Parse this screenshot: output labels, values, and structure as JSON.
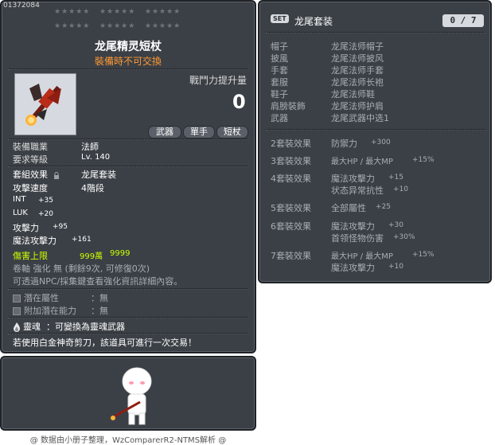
{
  "item_id": "01372084",
  "stars_row1": [
    "★★★★★",
    "★★★★★",
    "★★★★★"
  ],
  "stars_row2": [
    "★★★★★",
    "★★★★★",
    "★★★★★"
  ],
  "item_name": "龙尾精灵短杖",
  "untradeable": "裝備時不可交換",
  "power_label": "戰鬥力提升量",
  "power_value": "0",
  "tags": [
    "武器",
    "單手",
    "短杖"
  ],
  "req": [
    {
      "label": "裝備職業",
      "value": "法師"
    },
    {
      "label": "要求等級",
      "value": "Lv. 140"
    }
  ],
  "set_effect_label": "套組效果",
  "set_effect_value": "龙尾套装",
  "attack_speed_label": "攻擊速度",
  "attack_speed_value": "4階段",
  "stats": [
    {
      "label": "INT",
      "value": "+35"
    },
    {
      "label": "LUK",
      "value": "+20"
    },
    {
      "label": "攻擊力",
      "value": "+95"
    },
    {
      "label": "魔法攻擊力",
      "value": "+161"
    }
  ],
  "damage_cap_label": "傷害上限",
  "damage_cap_value1": "999萬",
  "damage_cap_value2": "9999",
  "scroll_line": "卷軸 強化 無 (剩餘9次, 可修復0次)",
  "npc_line": "可透過NPC/採集鍵查看強化資訊詳細內容。",
  "potential_label": "潛在屬性",
  "potential_value": "：無",
  "add_potential_label": "附加潛在能力",
  "add_potential_value": "：無",
  "soul_label": "靈魂",
  "soul_value": "：可變換為靈魂武器",
  "scissors_line": "若使用白金神奇剪刀，該道具可進行一次交易！",
  "set_panel": {
    "set_badge": "SET",
    "title": "龙尾套装",
    "count": "0 / 7",
    "items": [
      {
        "slot": "帽子",
        "name": "龙尾法师帽子"
      },
      {
        "slot": "披風",
        "name": "龙尾法师披风"
      },
      {
        "slot": "手套",
        "name": "龙尾法师手套"
      },
      {
        "slot": "套服",
        "name": "龙尾法师长袍"
      },
      {
        "slot": "鞋子",
        "name": "龙尾法师鞋"
      },
      {
        "slot": "肩膀裝飾",
        "name": "龙尾法师护肩"
      },
      {
        "slot": "武器",
        "name": "龙尾武器中选1"
      }
    ],
    "effects": [
      {
        "label": "2套裝效果",
        "lines": [
          {
            "text": "防禦力",
            "val": "+300"
          }
        ]
      },
      {
        "label": "3套裝效果",
        "lines": [
          {
            "text": "最大HP / 最大MP",
            "val": "+15%"
          }
        ]
      },
      {
        "label": "4套裝效果",
        "lines": [
          {
            "text": "魔法攻擊力",
            "val": "+15"
          },
          {
            "text": "状态异常抗性",
            "val": "+10"
          }
        ]
      },
      {
        "label": "5套裝效果",
        "lines": [
          {
            "text": "全部屬性",
            "val": "+25"
          }
        ]
      },
      {
        "label": "6套裝效果",
        "lines": [
          {
            "text": "魔法攻擊力",
            "val": "+30"
          },
          {
            "text": "首领怪物伤害",
            "val": "+30%"
          }
        ]
      },
      {
        "label": "7套裝效果",
        "lines": [
          {
            "text": "最大HP / 最大MP",
            "val": "+15%"
          },
          {
            "text": "魔法攻擊力",
            "val": "+10"
          }
        ]
      }
    ]
  },
  "footer": "@ 数据由小册子整理，WzComparerR2-NTMS解析 @",
  "colors": {
    "panel_bg": "#3b4046",
    "name_white": "#ffffff",
    "untradeable_orange": "#ff9933",
    "damage_cap_yellow": "#ccff00",
    "gray_text": "#a9adb2"
  },
  "icons": [
    "weapon-icon",
    "lock-icon",
    "soul-flame-icon",
    "character-preview"
  ]
}
